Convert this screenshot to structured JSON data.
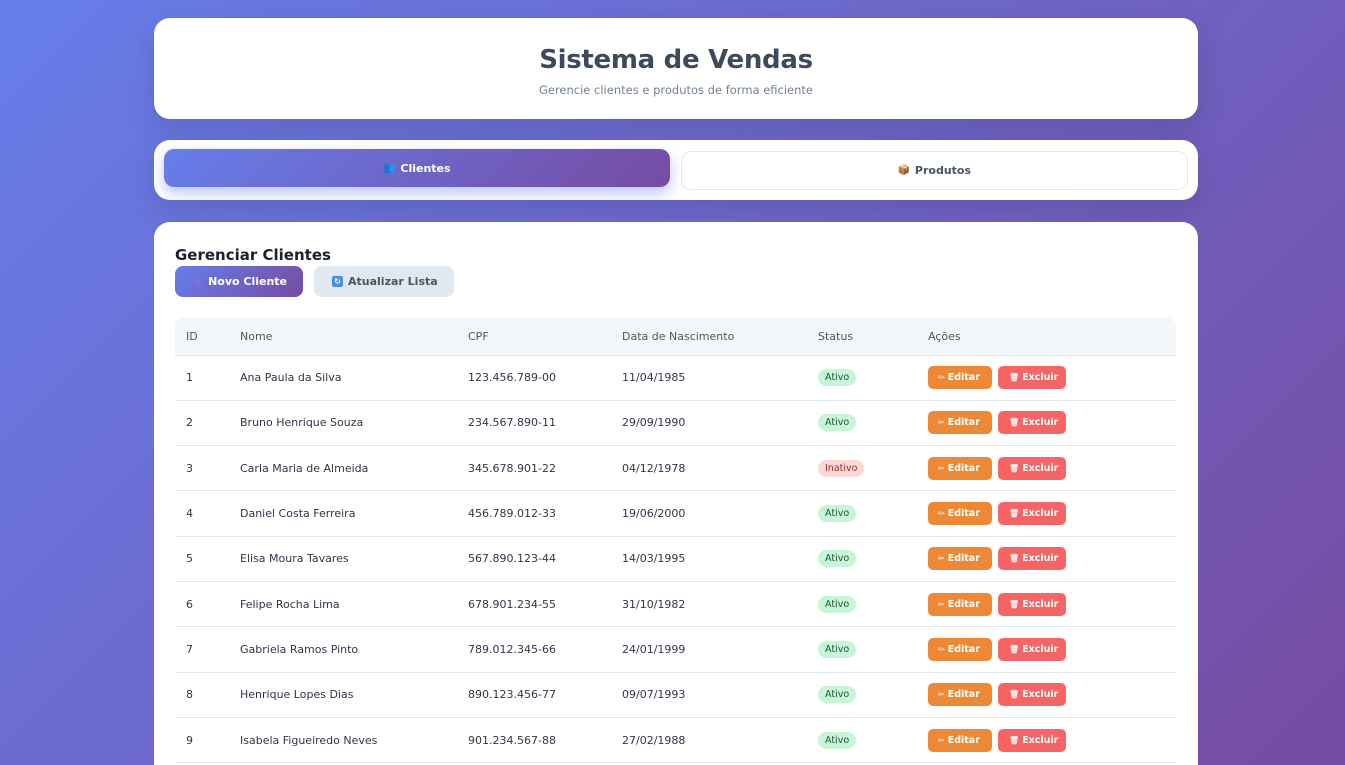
{
  "header": {
    "title": "Sistema de Vendas",
    "subtitle": "Gerencie clientes e produtos de forma eficiente"
  },
  "tabs": [
    {
      "label": "Clientes",
      "icon": "people-icon",
      "active": true
    },
    {
      "label": "Produtos",
      "icon": "package-icon",
      "active": false
    }
  ],
  "section": {
    "title": "Gerenciar Clientes",
    "new_label": "Novo Cliente",
    "refresh_label": "Atualizar Lista"
  },
  "table": {
    "headers": [
      "ID",
      "Nome",
      "CPF",
      "Data de Nascimento",
      "Status",
      "Ações"
    ],
    "edit_label": "Editar",
    "delete_label": "Excluir",
    "rows": [
      {
        "id": "1",
        "nome": "Ana Paula da Silva",
        "cpf": "123.456.789-00",
        "nasc": "11/04/1985",
        "status": "Ativo"
      },
      {
        "id": "2",
        "nome": "Bruno Henrique Souza",
        "cpf": "234.567.890-11",
        "nasc": "29/09/1990",
        "status": "Ativo"
      },
      {
        "id": "3",
        "nome": "Carla Maria de Almeida",
        "cpf": "345.678.901-22",
        "nasc": "04/12/1978",
        "status": "Inativo"
      },
      {
        "id": "4",
        "nome": "Daniel Costa Ferreira",
        "cpf": "456.789.012-33",
        "nasc": "19/06/2000",
        "status": "Ativo"
      },
      {
        "id": "5",
        "nome": "Elisa Moura Tavares",
        "cpf": "567.890.123-44",
        "nasc": "14/03/1995",
        "status": "Ativo"
      },
      {
        "id": "6",
        "nome": "Felipe Rocha Lima",
        "cpf": "678.901.234-55",
        "nasc": "31/10/1982",
        "status": "Ativo"
      },
      {
        "id": "7",
        "nome": "Gabriela Ramos Pinto",
        "cpf": "789.012.345-66",
        "nasc": "24/01/1999",
        "status": "Ativo"
      },
      {
        "id": "8",
        "nome": "Henrique Lopes Dias",
        "cpf": "890.123.456-77",
        "nasc": "09/07/1993",
        "status": "Ativo"
      },
      {
        "id": "9",
        "nome": "Isabela Figueiredo Neves",
        "cpf": "901.234.567-88",
        "nasc": "27/02/1988",
        "status": "Ativo"
      }
    ]
  },
  "colors": {
    "gradient_start": "#667eea",
    "gradient_end": "#764ba2",
    "edit": "#ed8936",
    "delete": "#f56565",
    "active_badge": "#c6f6d5",
    "inactive_badge": "#fed7d7"
  }
}
